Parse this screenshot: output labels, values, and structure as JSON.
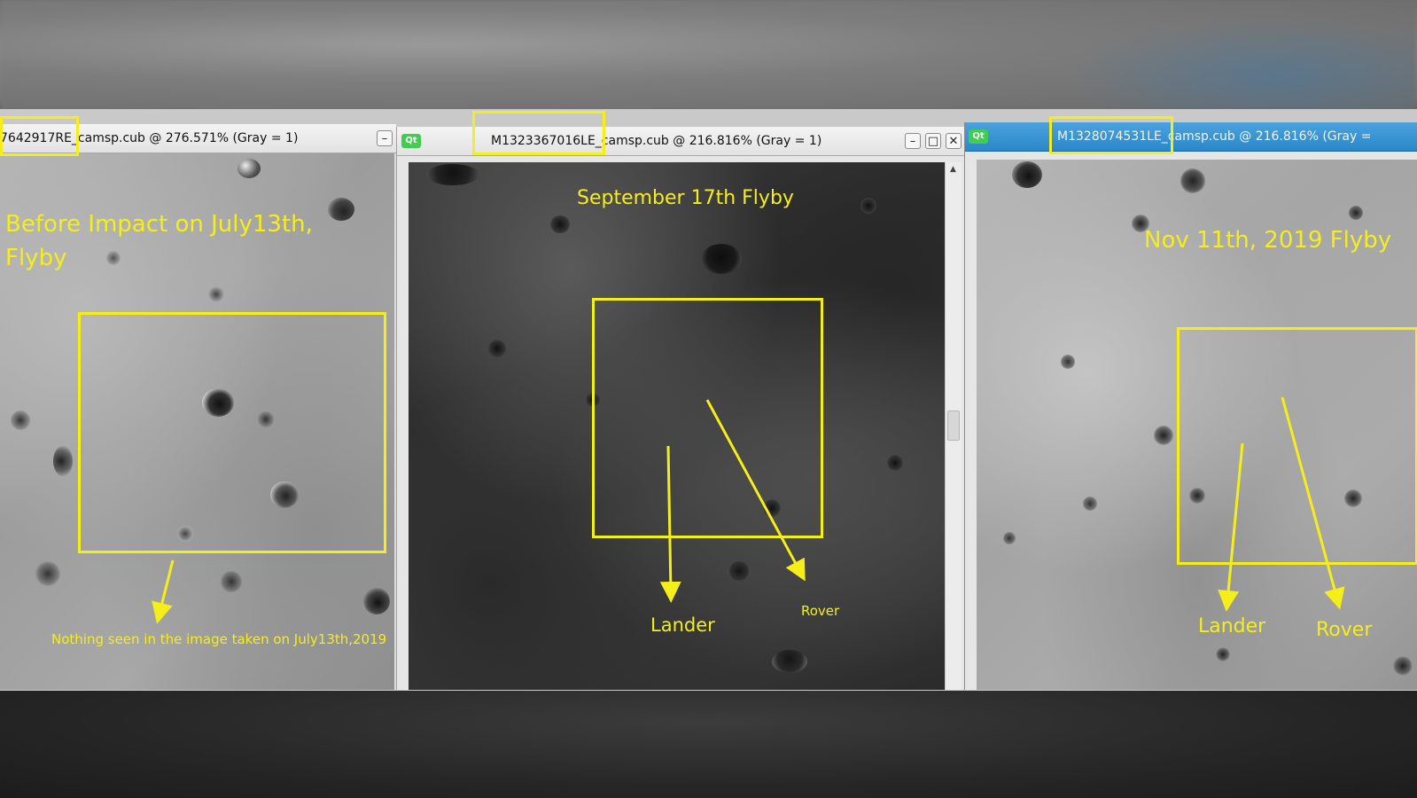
{
  "windows": [
    {
      "title": "7642917RE_camsp.cub @ 276.571% (Gray = 1)",
      "minimize_glyph": "–",
      "heading": "Before Impact on July13th,",
      "heading2": "Flyby",
      "note": "Nothing seen in the image taken on July13th,2019"
    },
    {
      "title": "M1323367016LE_camsp.cub @ 216.816% (Gray = 1)",
      "app_badge": "Qt",
      "minimize_glyph": "–",
      "maximize_glyph": "□",
      "close_glyph": "✕",
      "scroll_up_glyph": "▲",
      "heading": "September 17th Flyby",
      "label_lander": "Lander",
      "label_rover": "Rover"
    },
    {
      "title": "M1328074531LE_camsp.cub @ 216.816% (Gray =",
      "app_badge": "Qt",
      "heading": "Nov 11th, 2019 Flyby",
      "label_lander": "Lander",
      "label_rover": "Rover"
    }
  ],
  "colors": {
    "annotation_yellow": "#f5ee1a",
    "active_titlebar": "#2b87c9",
    "qt_badge": "#41cd52"
  }
}
